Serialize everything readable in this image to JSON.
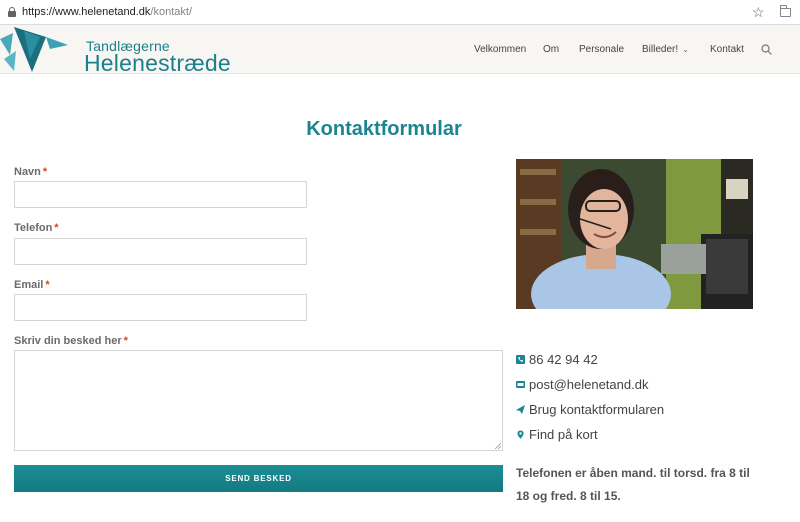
{
  "browser": {
    "url_host": "https://www.helenetand.dk",
    "url_path": "/kontakt/"
  },
  "header": {
    "logo_line1": "Tandlægerne",
    "logo_line2": "Helenestræde",
    "nav": [
      {
        "label": "Velkommen"
      },
      {
        "label": "Om"
      },
      {
        "label": "Personale"
      },
      {
        "label": "Billeder!"
      },
      {
        "label": "Kontakt"
      }
    ]
  },
  "form": {
    "title": "Kontaktformular",
    "fields": [
      {
        "label": "Navn",
        "required": "*",
        "value": ""
      },
      {
        "label": "Telefon",
        "required": "*",
        "value": ""
      },
      {
        "label": "Email",
        "required": "*",
        "value": ""
      },
      {
        "label": "Skriv din besked her",
        "required": "*",
        "value": ""
      }
    ],
    "submit_label": "SEND BESKED"
  },
  "contact": {
    "phone": "86 42 94 42",
    "email": "post@helenetand.dk",
    "form_link": "Brug kontaktformularen",
    "map_link": "Find på kort",
    "hours": "Telefonen er åben mand. til torsd. fra 8 til 18 og fred. 8 til 15."
  },
  "colors": {
    "accent": "#1b8592",
    "required": "#e2401c",
    "button": "#16838a"
  }
}
